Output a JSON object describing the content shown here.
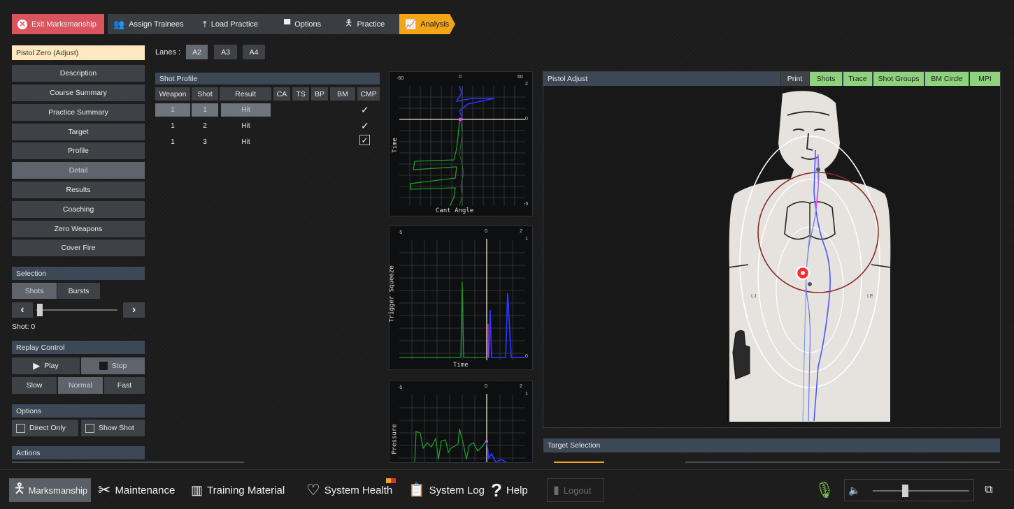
{
  "topbar": {
    "crumbs": [
      {
        "label": "Exit Marksmanship",
        "icon": "close-circle-icon"
      },
      {
        "label": "Assign Trainees",
        "icon": "people-icon"
      },
      {
        "label": "Load Practice",
        "icon": "upload-icon"
      },
      {
        "label": "Options",
        "icon": "panel-icon"
      },
      {
        "label": "Practice",
        "icon": "shooter-icon"
      },
      {
        "label": "Analysis",
        "icon": "chart-icon"
      }
    ]
  },
  "sidebar": {
    "course_title": "Pistol Zero (Adjust)",
    "menu": [
      "Description",
      "Course Summary",
      "Practice Summary",
      "Target",
      "Profile",
      "Detail",
      "Results",
      "Coaching",
      "Zero Weapons",
      "Cover Fire"
    ],
    "selected_menu": "Detail",
    "selection": {
      "header": "Selection",
      "shots": "Shots",
      "bursts": "Bursts",
      "shot_readout": "Shot: 0",
      "slider_value": 0
    },
    "replay": {
      "header": "Replay Control",
      "play": "Play",
      "stop": "Stop",
      "slow": "Slow",
      "normal": "Normal",
      "fast": "Fast"
    },
    "options": {
      "header": "Options",
      "direct_only": "Direct Only",
      "show_shot": "Show Shot"
    },
    "actions": {
      "header": "Actions"
    }
  },
  "lanes": {
    "label": "Lanes :",
    "items": [
      "A2",
      "A3",
      "A4"
    ],
    "selected": "A2"
  },
  "shot_profile": {
    "header": "Shot Profile",
    "columns": [
      "Weapon",
      "Shot",
      "Result",
      "CA",
      "TS",
      "BP",
      "BM",
      "CMP"
    ],
    "rows": [
      {
        "weapon": "1",
        "shot": "1",
        "result": "Hit",
        "cmp": "✓"
      },
      {
        "weapon": "1",
        "shot": "2",
        "result": "Hit",
        "cmp": "✓"
      },
      {
        "weapon": "1",
        "shot": "3",
        "result": "Hit",
        "cmp": "✓"
      }
    ]
  },
  "charts": {
    "cant": {
      "ylabel": "Time",
      "xlabel": "Cant Angle",
      "top_ticks": [
        "-60",
        "0",
        "60"
      ],
      "right_ticks": [
        "2",
        "0",
        "-5"
      ]
    },
    "trigger": {
      "ylabel": "Trigger Squeeze",
      "xlabel": "Time",
      "top_ticks": [
        "-5",
        "0",
        "2"
      ],
      "right_ticks": [
        "1",
        "0"
      ]
    },
    "pressure": {
      "ylabel": "Pressure",
      "top_ticks": [
        "-5",
        "0",
        "2"
      ],
      "right_ticks": [
        "1"
      ]
    }
  },
  "pistol_panel": {
    "header": "Pistol Adjust",
    "tabs": [
      "Print",
      "Shots",
      "Trace",
      "Shot Groups",
      "BM Circle",
      "MPI"
    ],
    "target_labels": {
      "left": "LJ",
      "right": "LE"
    }
  },
  "target_selection": {
    "header": "Target Selection"
  },
  "bottombar": {
    "items": [
      {
        "label": "Marksmanship",
        "icon": "shooter-icon"
      },
      {
        "label": "Maintenance",
        "icon": "tools-icon"
      },
      {
        "label": "Training Material",
        "icon": "book-icon"
      },
      {
        "label": "System Health",
        "icon": "heart-health-icon"
      },
      {
        "label": "System Log",
        "icon": "clipboard-icon"
      },
      {
        "label": "Help",
        "icon": "question-icon"
      },
      {
        "label": "Logout",
        "icon": "logout-icon"
      }
    ],
    "volume_level": 0.35
  },
  "colors": {
    "accent": "#f2a516",
    "exit": "#d9545e",
    "tab_green": "#8ed27d",
    "header_blue": "#3c4856",
    "mic_green": "#7dc043"
  }
}
